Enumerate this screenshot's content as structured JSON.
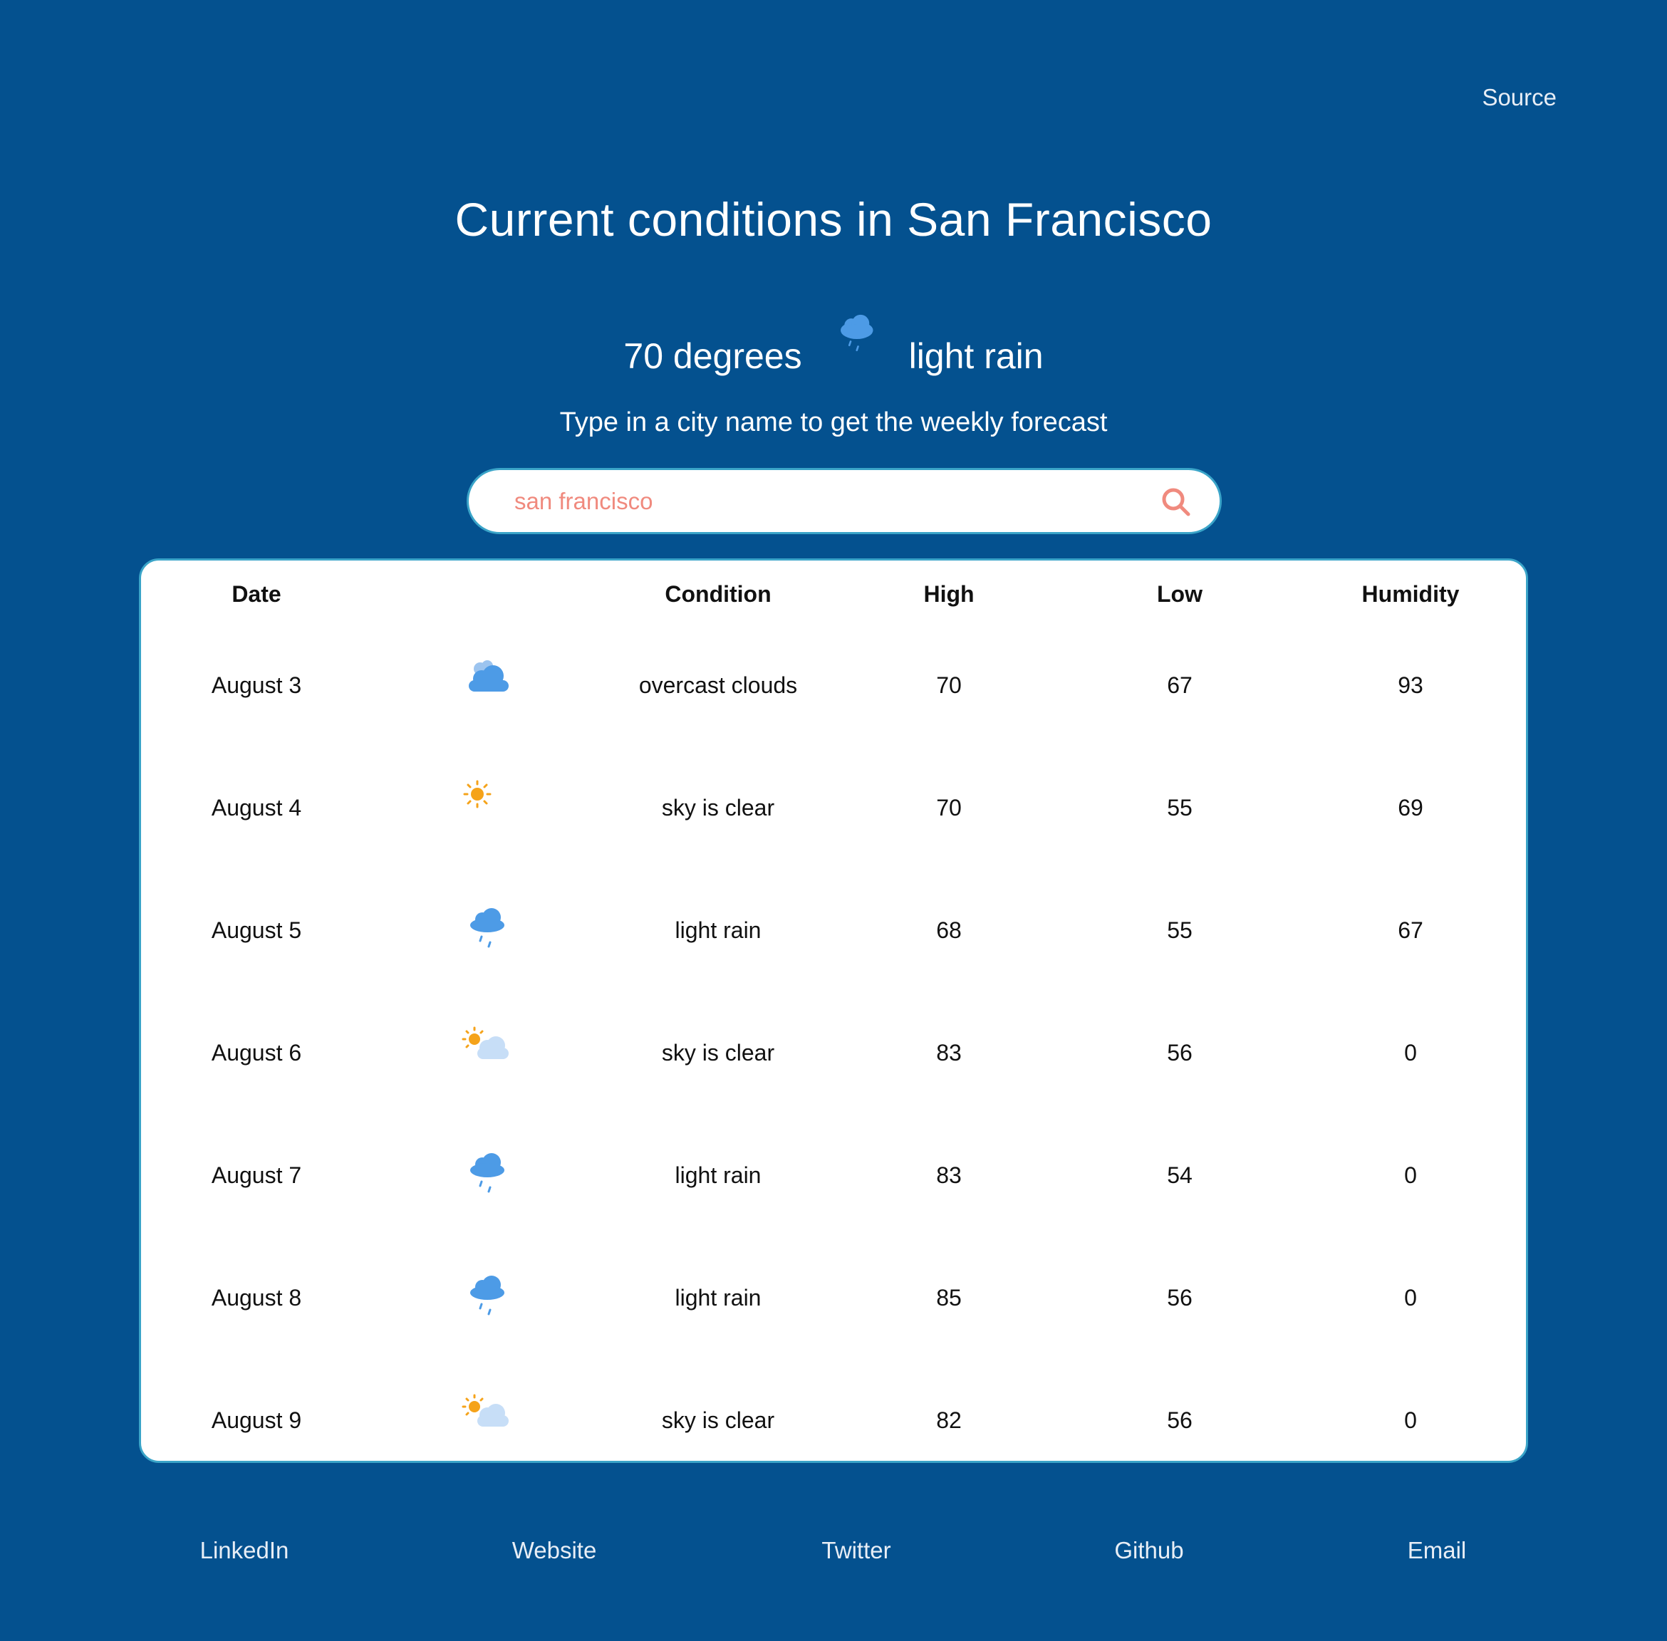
{
  "header": {
    "source_link": "Source",
    "title": "Current conditions in San Francisco"
  },
  "current": {
    "temperature": "70 degrees",
    "condition": "light rain",
    "icon": "rain-cloud-icon"
  },
  "prompt": "Type in a city name to get the weekly forecast",
  "search": {
    "value": "san francisco",
    "icon": "search-icon"
  },
  "table": {
    "headers": {
      "date": "Date",
      "icon": "",
      "condition": "Condition",
      "high": "High",
      "low": "Low",
      "humidity": "Humidity"
    },
    "rows": [
      {
        "date": "August 3",
        "icon": "overcast-cloud-icon",
        "condition": "overcast clouds",
        "high": "70",
        "low": "67",
        "humidity": "93"
      },
      {
        "date": "August 4",
        "icon": "sun-icon",
        "condition": "sky is clear",
        "high": "70",
        "low": "55",
        "humidity": "69"
      },
      {
        "date": "August 5",
        "icon": "rain-cloud-icon",
        "condition": "light rain",
        "high": "68",
        "low": "55",
        "humidity": "67"
      },
      {
        "date": "August 6",
        "icon": "sun-cloud-icon",
        "condition": "sky is clear",
        "high": "83",
        "low": "56",
        "humidity": "0"
      },
      {
        "date": "August 7",
        "icon": "rain-cloud-icon",
        "condition": "light rain",
        "high": "83",
        "low": "54",
        "humidity": "0"
      },
      {
        "date": "August 8",
        "icon": "rain-cloud-icon",
        "condition": "light rain",
        "high": "85",
        "low": "56",
        "humidity": "0"
      },
      {
        "date": "August 9",
        "icon": "sun-cloud-icon",
        "condition": "sky is clear",
        "high": "82",
        "low": "56",
        "humidity": "0"
      }
    ]
  },
  "footer": {
    "links": [
      "LinkedIn",
      "Website",
      "Twitter",
      "Github",
      "Email"
    ]
  },
  "colors": {
    "background": "#04518f",
    "card": "#ffffff",
    "card_border": "#3aa4c8",
    "search_text": "#f08a7e",
    "cloud_blue": "#4d9be6",
    "sun_orange": "#f5a31a"
  }
}
